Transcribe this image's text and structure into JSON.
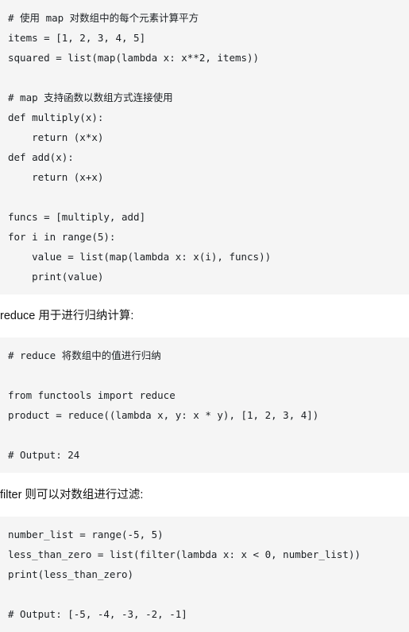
{
  "document": {
    "theme": {
      "page_background": "#ffffff",
      "code_background": "#f5f5f5",
      "code_text": "#1b1f23",
      "paragraph_text": "#111111"
    },
    "blocks": [
      {
        "type": "code",
        "name": "map-example-code",
        "language": "python",
        "lines": [
          "# 使用 map 对数组中的每个元素计算平方",
          "items = [1, 2, 3, 4, 5]",
          "squared = list(map(lambda x: x**2, items))",
          "",
          "# map 支持函数以数组方式连接使用",
          "def multiply(x):",
          "    return (x*x)",
          "def add(x):",
          "    return (x+x)",
          "",
          "funcs = [multiply, add]",
          "for i in range(5):",
          "    value = list(map(lambda x: x(i), funcs))",
          "    print(value)"
        ]
      },
      {
        "type": "paragraph",
        "name": "reduce-description",
        "text": "reduce 用于进行归纳计算:"
      },
      {
        "type": "code",
        "name": "reduce-example-code",
        "language": "python",
        "lines": [
          "# reduce 将数组中的值进行归纳",
          "",
          "from functools import reduce",
          "product = reduce((lambda x, y: x * y), [1, 2, 3, 4])",
          "",
          "# Output: 24"
        ]
      },
      {
        "type": "paragraph",
        "name": "filter-description",
        "text": "filter 则可以对数组进行过滤:"
      },
      {
        "type": "code",
        "name": "filter-example-code",
        "language": "python",
        "lines": [
          "number_list = range(-5, 5)",
          "less_than_zero = list(filter(lambda x: x < 0, number_list))",
          "print(less_than_zero)",
          "",
          "# Output: [-5, -4, -3, -2, -1]"
        ]
      }
    ]
  }
}
